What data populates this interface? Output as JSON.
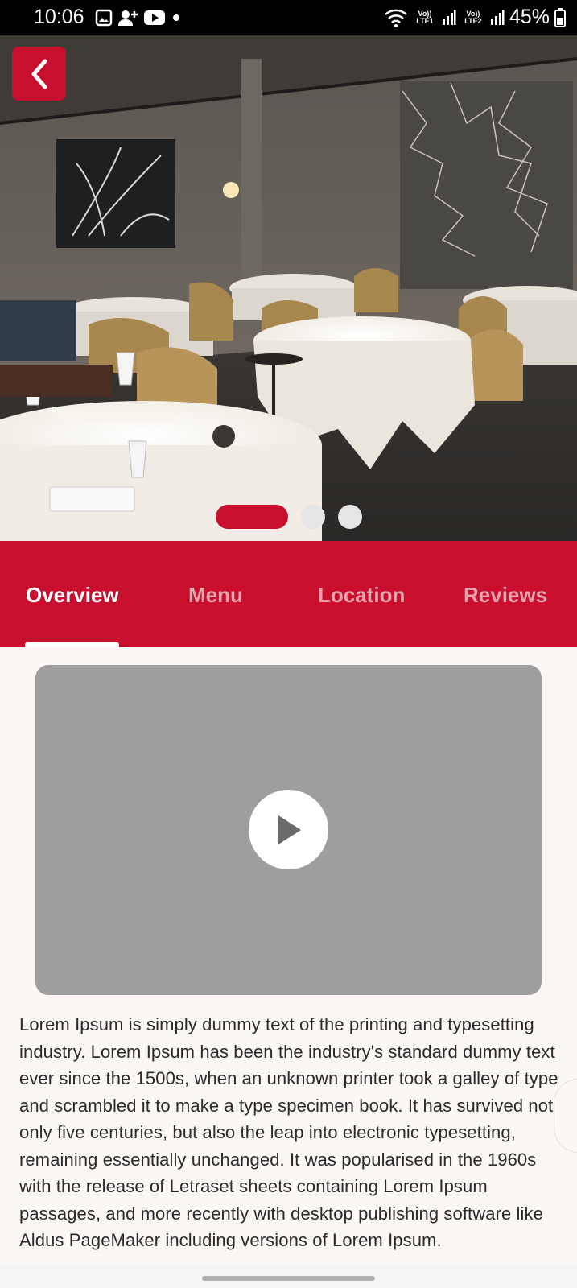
{
  "status_bar": {
    "time": "10:06",
    "left_icons": [
      "gallery-icon",
      "add-contact-icon",
      "youtube-icon",
      "dot-icon"
    ],
    "sim1": "Vo)) LTE1",
    "sim2": "Vo)) LTE2",
    "battery": "45%"
  },
  "hero": {
    "image": "restaurant-dining-room",
    "carousel": {
      "count": 3,
      "active": 0
    }
  },
  "tabs": [
    {
      "label": "Overview",
      "active": true
    },
    {
      "label": "Menu",
      "active": false
    },
    {
      "label": "Location",
      "active": false
    },
    {
      "label": "Reviews",
      "active": false
    }
  ],
  "video": {
    "icon": "play-icon"
  },
  "description": "Lorem Ipsum is simply dummy text of the printing and typesetting industry. Lorem Ipsum has been the industry's standard dummy text ever since the 1500s, when an unknown printer took a galley of type and scrambled it to make a type specimen book. It has survived not only five centuries, but also the leap into electronic typesetting, remaining essentially unchanged. It was popularised in the 1960s with the release of Letraset sheets containing Lorem Ipsum passages, and more recently with desktop publishing software like Aldus PageMaker including versions of Lorem Ipsum.",
  "colors": {
    "accent": "#c8102e",
    "background": "#fcf6f5",
    "video_placeholder": "#9e9e9e"
  }
}
